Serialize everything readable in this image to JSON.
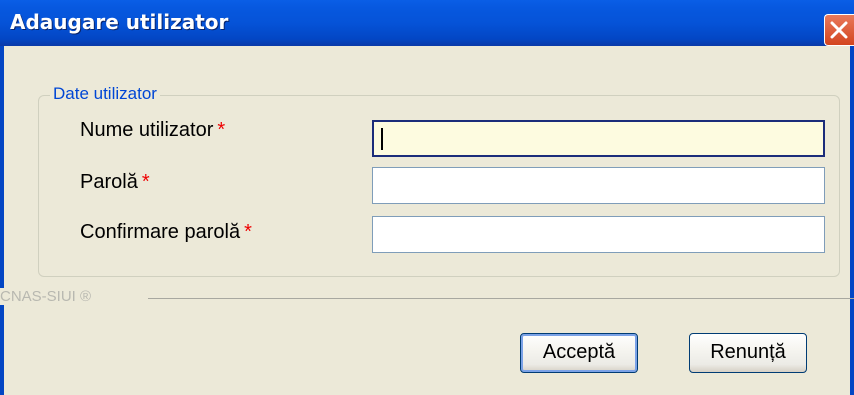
{
  "window": {
    "title": "Adaugare utilizator",
    "close_icon": "close-icon"
  },
  "group": {
    "legend": "Date utilizator"
  },
  "fields": [
    {
      "label": "Nume utilizator",
      "required_mark": "*",
      "value": ""
    },
    {
      "label": "Parolă",
      "required_mark": "*",
      "value": ""
    },
    {
      "label": "Confirmare parolă",
      "required_mark": "*",
      "value": ""
    }
  ],
  "footer": {
    "brand": "CNAS-SIUI ®"
  },
  "buttons": {
    "accept": "Acceptă",
    "cancel": "Renunță"
  },
  "colors": {
    "titlebar": "#0553d8",
    "required": "#ee0000",
    "legend": "#0046d5",
    "active_input_bg": "#fdfbe0"
  }
}
